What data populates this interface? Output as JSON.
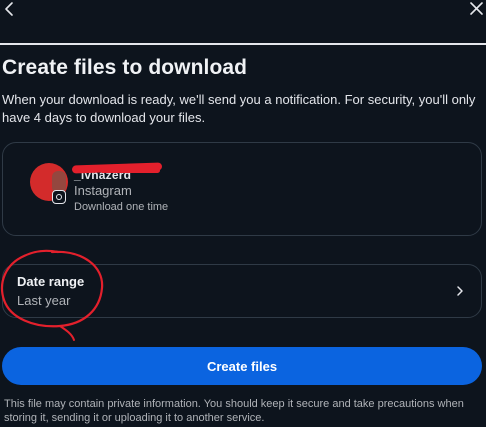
{
  "header": {
    "back_icon": "chevron-left-icon",
    "close_icon": "close-icon"
  },
  "main": {
    "title": "Create files to download",
    "description": "When your download is ready, we'll send you a notification. For security, you'll only have 4 days to download your files."
  },
  "account": {
    "username": "_ivhazerd",
    "platform": "Instagram",
    "platform_icon": "instagram-icon",
    "download_frequency": "Download one time"
  },
  "date_range": {
    "label": "Date range",
    "value": "Last year",
    "icon": "chevron-right-icon"
  },
  "actions": {
    "create_label": "Create files"
  },
  "footer": {
    "note": "This file may contain private information. You should keep it secure and take precautions when storing it, sending it or uploading it to another service."
  },
  "colors": {
    "background": "#0d141d",
    "primary_button": "#0b64e0",
    "annotation": "#e3202c"
  }
}
